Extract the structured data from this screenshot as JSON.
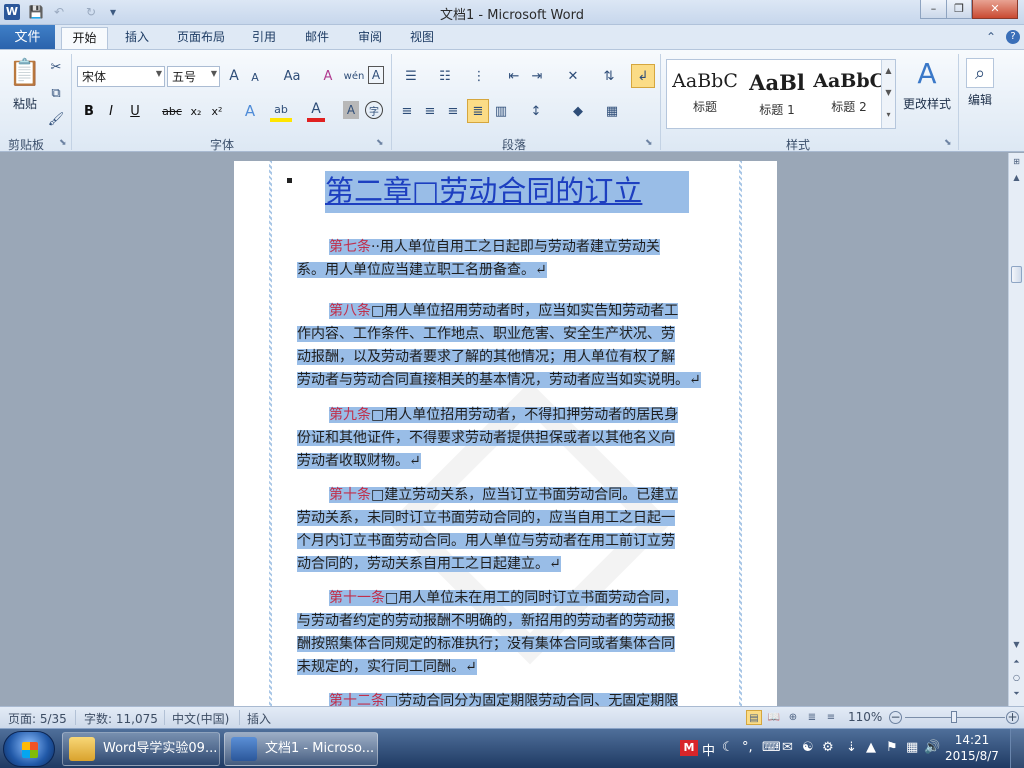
{
  "window": {
    "title": "文档1 - Microsoft Word",
    "app_icon_letter": "W"
  },
  "quick_access": {
    "save": "💾",
    "undo": "↶",
    "redo": "↻",
    "customize": "▾"
  },
  "window_controls": {
    "minimize": "–",
    "restore": "❐",
    "close": "✕"
  },
  "tabs": {
    "file": "文件",
    "items": [
      "开始",
      "插入",
      "页面布局",
      "引用",
      "邮件",
      "审阅",
      "视图"
    ],
    "active": "开始",
    "collapse": "⌃",
    "help": "?"
  },
  "clipboard": {
    "paste": "粘贴",
    "group": "剪贴板"
  },
  "font": {
    "name": "宋体",
    "size": "五号",
    "group": "字体",
    "grow": "A",
    "shrink": "A",
    "change_case": "Aa",
    "clear": "A",
    "phonetic": "wén",
    "border": "A",
    "bold": "B",
    "italic": "I",
    "underline": "U",
    "strike": "abc",
    "subscript": "x₂",
    "superscript": "x²",
    "effects": "A",
    "highlight": "ab",
    "color": "A",
    "shading": "A",
    "circle": "字"
  },
  "paragraph": {
    "group": "段落"
  },
  "styles": {
    "group": "样式",
    "items": [
      {
        "sample": "AaBbC",
        "name": "标题"
      },
      {
        "sample": "AaBl",
        "name": "标题 1"
      },
      {
        "sample": "AaBbC",
        "name": "标题 2"
      }
    ],
    "change_styles": "更改样式"
  },
  "editing": {
    "label": "编辑"
  },
  "document": {
    "heading": "第二章□劳动合同的订立",
    "paragraphs": [
      {
        "num": "第七条",
        "lines": [
          "··用人单位自用工之日起即与劳动者建立劳动关",
          "系。用人单位应当建立职工名册备查。↵"
        ]
      },
      {
        "num": "第八条",
        "lines": [
          "□用人单位招用劳动者时，应当如实告知劳动者工",
          "作内容、工作条件、工作地点、职业危害、安全生产状况、劳",
          "动报酬，以及劳动者要求了解的其他情况；用人单位有权了解",
          "劳动者与劳动合同直接相关的基本情况，劳动者应当如实说明。↵"
        ]
      },
      {
        "num": "第九条",
        "lines": [
          "□用人单位招用劳动者，不得扣押劳动者的居民身",
          "份证和其他证件，不得要求劳动者提供担保或者以其他名义向",
          "劳动者收取财物。↵"
        ]
      },
      {
        "num": "第十条",
        "lines": [
          "□建立劳动关系，应当订立书面劳动合同。已建立",
          "劳动关系，未同时订立书面劳动合同的，应当自用工之日起一",
          "个月内订立书面劳动合同。用人单位与劳动者在用工前订立劳",
          "动合同的，劳动关系自用工之日起建立。↵"
        ]
      },
      {
        "num": "第十一条",
        "lines": [
          "□用人单位未在用工的同时订立书面劳动合同，",
          "与劳动者约定的劳动报酬不明确的，新招用的劳动者的劳动报",
          "酬按照集体合同规定的标准执行；没有集体合同或者集体合同",
          "未规定的，实行同工同酬。↵"
        ]
      },
      {
        "num": "第十二条",
        "lines": [
          "□劳动合同分为固定期限劳动合同、无固定期限"
        ]
      }
    ]
  },
  "status": {
    "page": "页面: 5/35",
    "words": "字数: 11,075",
    "language": "中文(中国)",
    "mode": "插入",
    "zoom": "110%",
    "zoom_minus": "−",
    "zoom_plus": "+"
  },
  "taskbar": {
    "items": [
      {
        "label": "Word导学实验09...",
        "icon": "folder-icon"
      },
      {
        "label": "文档1 - Microso...",
        "icon": "word-icon"
      }
    ],
    "tray_ime": "中",
    "time": "14:21",
    "date": "2015/8/7"
  },
  "colors": {
    "selection": "#99bde7",
    "heading": "#1d3fc0",
    "article_number": "#c0304c"
  }
}
